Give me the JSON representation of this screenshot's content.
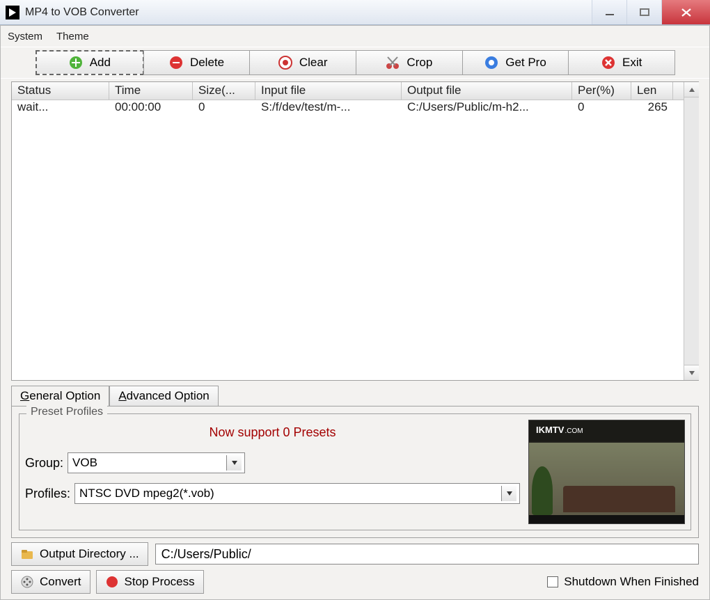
{
  "window": {
    "title": "MP4 to VOB Converter"
  },
  "menubar": {
    "system": "System",
    "theme": "Theme"
  },
  "toolbar": {
    "add": "Add",
    "delete": "Delete",
    "clear": "Clear",
    "crop": "Crop",
    "getpro": "Get Pro",
    "exit": "Exit"
  },
  "table": {
    "headers": {
      "status": "Status",
      "time": "Time",
      "size": "Size(...",
      "input": "Input file",
      "output": "Output file",
      "per": "Per(%)",
      "len": "Len"
    },
    "rows": [
      {
        "status": "wait...",
        "time": "00:00:00",
        "size": "0",
        "input": "S:/f/dev/test/m-...",
        "output": "C:/Users/Public/m-h2...",
        "per": "0",
        "len": "265"
      }
    ]
  },
  "tabs": {
    "general": "General Option",
    "advanced": "Advanced Option",
    "active": "general"
  },
  "preset": {
    "legend": "Preset Profiles",
    "message": "Now support 0 Presets",
    "group_label": "Group:",
    "group_value": "VOB",
    "profiles_label": "Profiles:",
    "profiles_value": "NTSC DVD mpeg2(*.vob)"
  },
  "preview": {
    "brand": "IKMTV",
    "brand_suffix": ".COM"
  },
  "output": {
    "button": "Output Directory ...",
    "path": "C:/Users/Public/"
  },
  "bottom": {
    "convert": "Convert",
    "stop": "Stop Process",
    "shutdown": "Shutdown When Finished",
    "shutdown_checked": false
  }
}
